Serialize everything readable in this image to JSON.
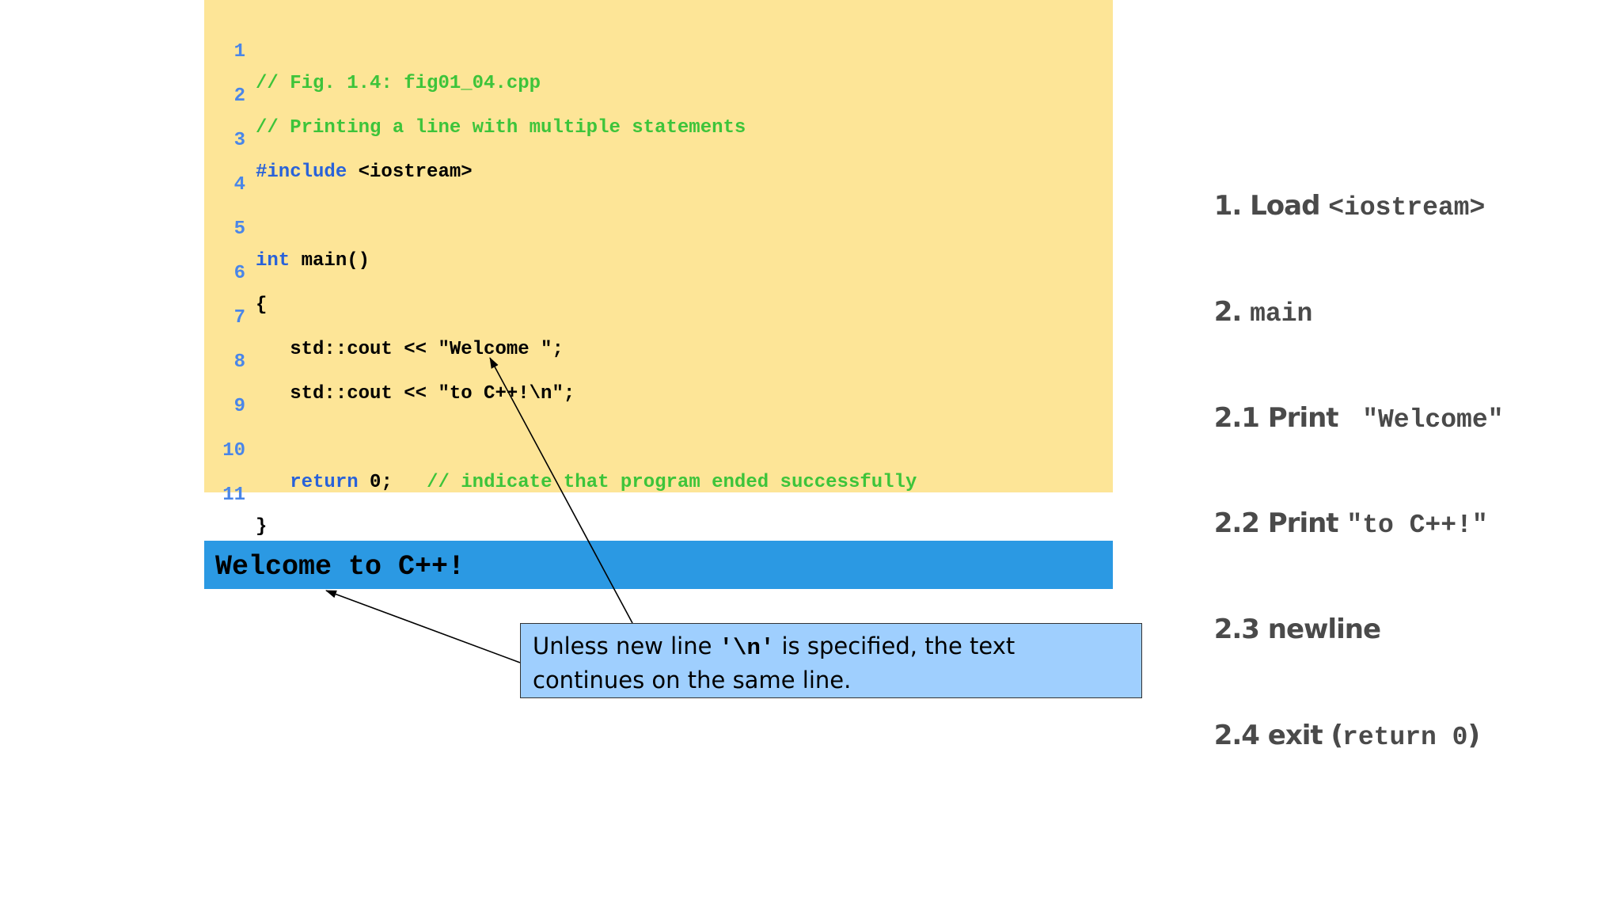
{
  "code": {
    "lines": [
      {
        "num": "1",
        "comment": "// Fig. 1.4: fig01_04.cpp"
      },
      {
        "num": "2",
        "comment": "// Printing a line with multiple statements"
      },
      {
        "num": "3",
        "kw": "#include",
        "text": " <iostream>"
      },
      {
        "num": "4"
      },
      {
        "num": "5",
        "kw": "int",
        "text": " main()"
      },
      {
        "num": "6",
        "text": "{"
      },
      {
        "num": "7",
        "text": "   std::cout << \"Welcome \";"
      },
      {
        "num": "8",
        "text": "   std::cout << \"to C++!\\n\";"
      },
      {
        "num": "9"
      },
      {
        "num": "10",
        "indent": "   ",
        "kw": "return",
        "text": " 0;   ",
        "comment": "// indicate that program ended successfully"
      },
      {
        "num": "11",
        "text": "}"
      }
    ]
  },
  "output": {
    "text": "Welcome to C++!"
  },
  "callout": {
    "before": "Unless new line ",
    "code": "'\\n'",
    "after": " is specified, the text continues on the same line."
  },
  "outline": [
    {
      "label": "1. Load ",
      "code": "<iostream>"
    },
    {
      "label": "2. ",
      "code": "main"
    },
    {
      "label": "2.1 Print ",
      "code": " \"Welcome\""
    },
    {
      "label": "2.2 Print ",
      "code": "\"to C++!\""
    },
    {
      "label": "2.3 newline",
      "code": ""
    },
    {
      "label": "2.4 exit (",
      "code": "return 0",
      "suffix": ")"
    }
  ],
  "colors": {
    "code_bg": "#fde597",
    "output_bg": "#2b99e3",
    "callout_bg": "#9fcffe",
    "comment": "#3dc43a",
    "keyword": "#2962d9",
    "line_number": "#4a86e8"
  }
}
